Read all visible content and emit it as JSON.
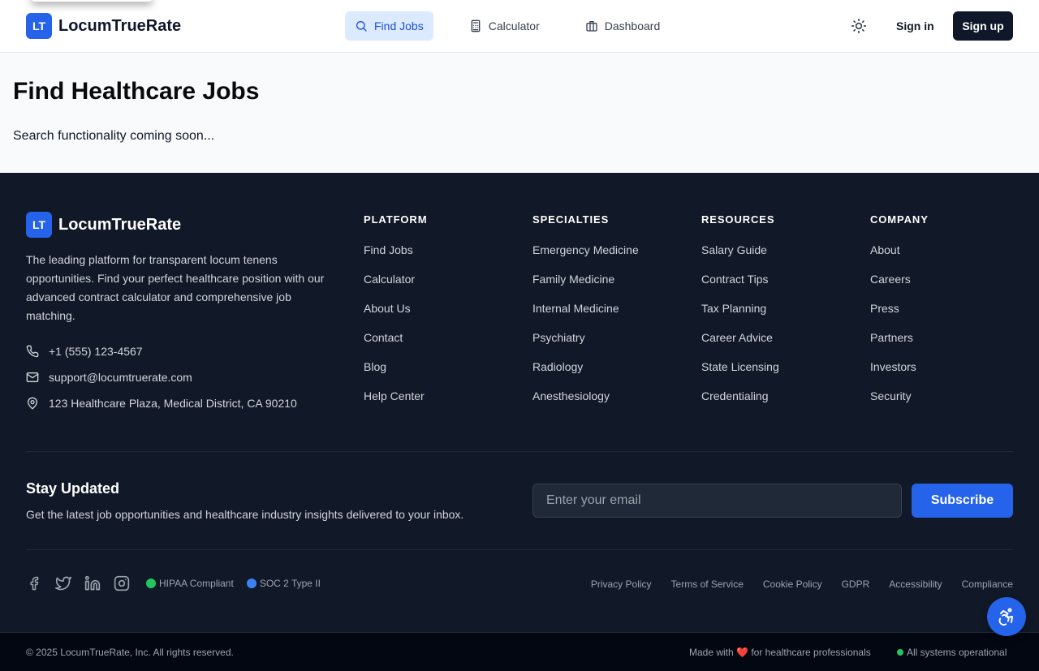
{
  "brand": {
    "badge": "LT",
    "name": "LocumTrueRate"
  },
  "nav": {
    "items": [
      {
        "label": "Find Jobs",
        "icon": "search-icon",
        "active": true
      },
      {
        "label": "Calculator",
        "icon": "calculator-icon",
        "active": false
      },
      {
        "label": "Dashboard",
        "icon": "briefcase-icon",
        "active": false
      }
    ],
    "sign_in": "Sign in",
    "sign_up": "Sign up"
  },
  "main": {
    "title": "Find Healthcare Jobs",
    "subtitle": "Search functionality coming soon..."
  },
  "footer": {
    "description": "The leading platform for transparent locum tenens opportunities. Find your perfect healthcare position with our advanced contract calculator and comprehensive job matching.",
    "contact": {
      "phone": "+1 (555) 123-4567",
      "email": "support@locumtruerate.com",
      "address": "123 Healthcare Plaza, Medical District, CA 90210"
    },
    "columns": [
      {
        "title": "PLATFORM",
        "links": [
          "Find Jobs",
          "Calculator",
          "About Us",
          "Contact",
          "Blog",
          "Help Center"
        ]
      },
      {
        "title": "SPECIALTIES",
        "links": [
          "Emergency Medicine",
          "Family Medicine",
          "Internal Medicine",
          "Psychiatry",
          "Radiology",
          "Anesthesiology"
        ]
      },
      {
        "title": "RESOURCES",
        "links": [
          "Salary Guide",
          "Contract Tips",
          "Tax Planning",
          "Career Advice",
          "State Licensing",
          "Credentialing"
        ]
      },
      {
        "title": "COMPANY",
        "links": [
          "About",
          "Careers",
          "Press",
          "Partners",
          "Investors",
          "Security"
        ]
      }
    ],
    "newsletter": {
      "title": "Stay Updated",
      "subtitle": "Get the latest job opportunities and healthcare industry insights delivered to your inbox.",
      "placeholder": "Enter your email",
      "button": "Subscribe"
    },
    "badges": [
      {
        "label": "HIPAA Compliant",
        "color": "#22c55e"
      },
      {
        "label": "SOC 2 Type II",
        "color": "#3b82f6"
      }
    ],
    "legal_links": [
      "Privacy Policy",
      "Terms of Service",
      "Cookie Policy",
      "GDPR",
      "Accessibility",
      "Compliance"
    ],
    "copyright": "© 2025 LocumTrueRate, Inc. All rights reserved.",
    "made_with_prefix": "Made with",
    "made_with_heart": "❤️",
    "made_with_suffix": "for healthcare professionals",
    "status": "All systems operational"
  },
  "colors": {
    "accent": "#2563eb",
    "footer_bg": "#111827",
    "dark": "#0f172a"
  }
}
